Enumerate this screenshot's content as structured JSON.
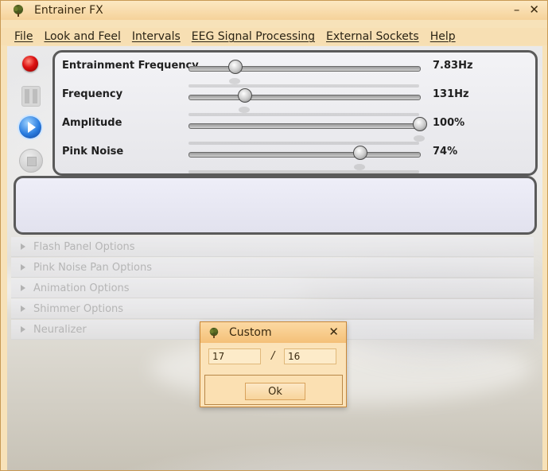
{
  "window": {
    "title": "Entrainer FX",
    "minimize_glyph": "–",
    "close_glyph": "✕"
  },
  "menu": [
    "File",
    "Look and Feel",
    "Intervals",
    "EEG Signal Processing",
    "External Sockets",
    "Help"
  ],
  "sliders": [
    {
      "label": "Entrainment Frequency",
      "value_text": "7.83Hz",
      "level": 0.2
    },
    {
      "label": "Frequency",
      "value_text": "131Hz",
      "level": 0.24
    },
    {
      "label": "Amplitude",
      "value_text": "100%",
      "level": 1.0
    },
    {
      "label": "Pink Noise",
      "value_text": "74%",
      "level": 0.74
    }
  ],
  "collapsibles": [
    "Flash Panel Options",
    "Pink Noise Pan Options",
    "Animation Options",
    "Shimmer Options",
    "Neuralizer"
  ],
  "dialog": {
    "title": "Custom",
    "close_glyph": "✕",
    "numerator": "17",
    "separator": "/",
    "denominator": "16",
    "ok_label": "Ok"
  },
  "icons": {
    "app": "tree-icon",
    "record": "record-icon",
    "pause": "pause-icon",
    "play": "play-icon",
    "stop": "stop-icon"
  },
  "colors": {
    "title_bar": "#f5d29a",
    "menu_bar": "#f7dfb3",
    "dialog_bg": "#fbe3b9",
    "panel_border": "#5a5a5a"
  }
}
